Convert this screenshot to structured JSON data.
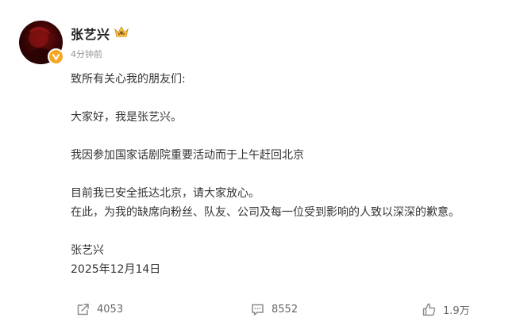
{
  "user": {
    "name": "张艺兴",
    "timestamp": "4分钟前"
  },
  "post": {
    "lines": [
      "致所有关心我的朋友们:",
      "大家好，我是张艺兴。",
      "我因参加国家话剧院重要活动而于上午赶回北京",
      "目前我已安全抵达北京，请大家放心。",
      "在此，为我的缺席向粉丝、队友、公司及每一位受到影响的人致以深深的歉意。",
      "张艺兴",
      "2025年12月14日"
    ]
  },
  "actions": {
    "repost_count": "4053",
    "comment_count": "8552",
    "like_count": "1.9万"
  },
  "icons": {
    "verified": "verified-badge-icon",
    "vip": "vip-crown-icon",
    "repost": "repost-icon",
    "comment": "comment-icon",
    "like": "like-icon"
  },
  "colors": {
    "verified_badge": "#f5a623",
    "text_primary": "#333333",
    "text_secondary": "#939393",
    "action_text": "#666666"
  }
}
